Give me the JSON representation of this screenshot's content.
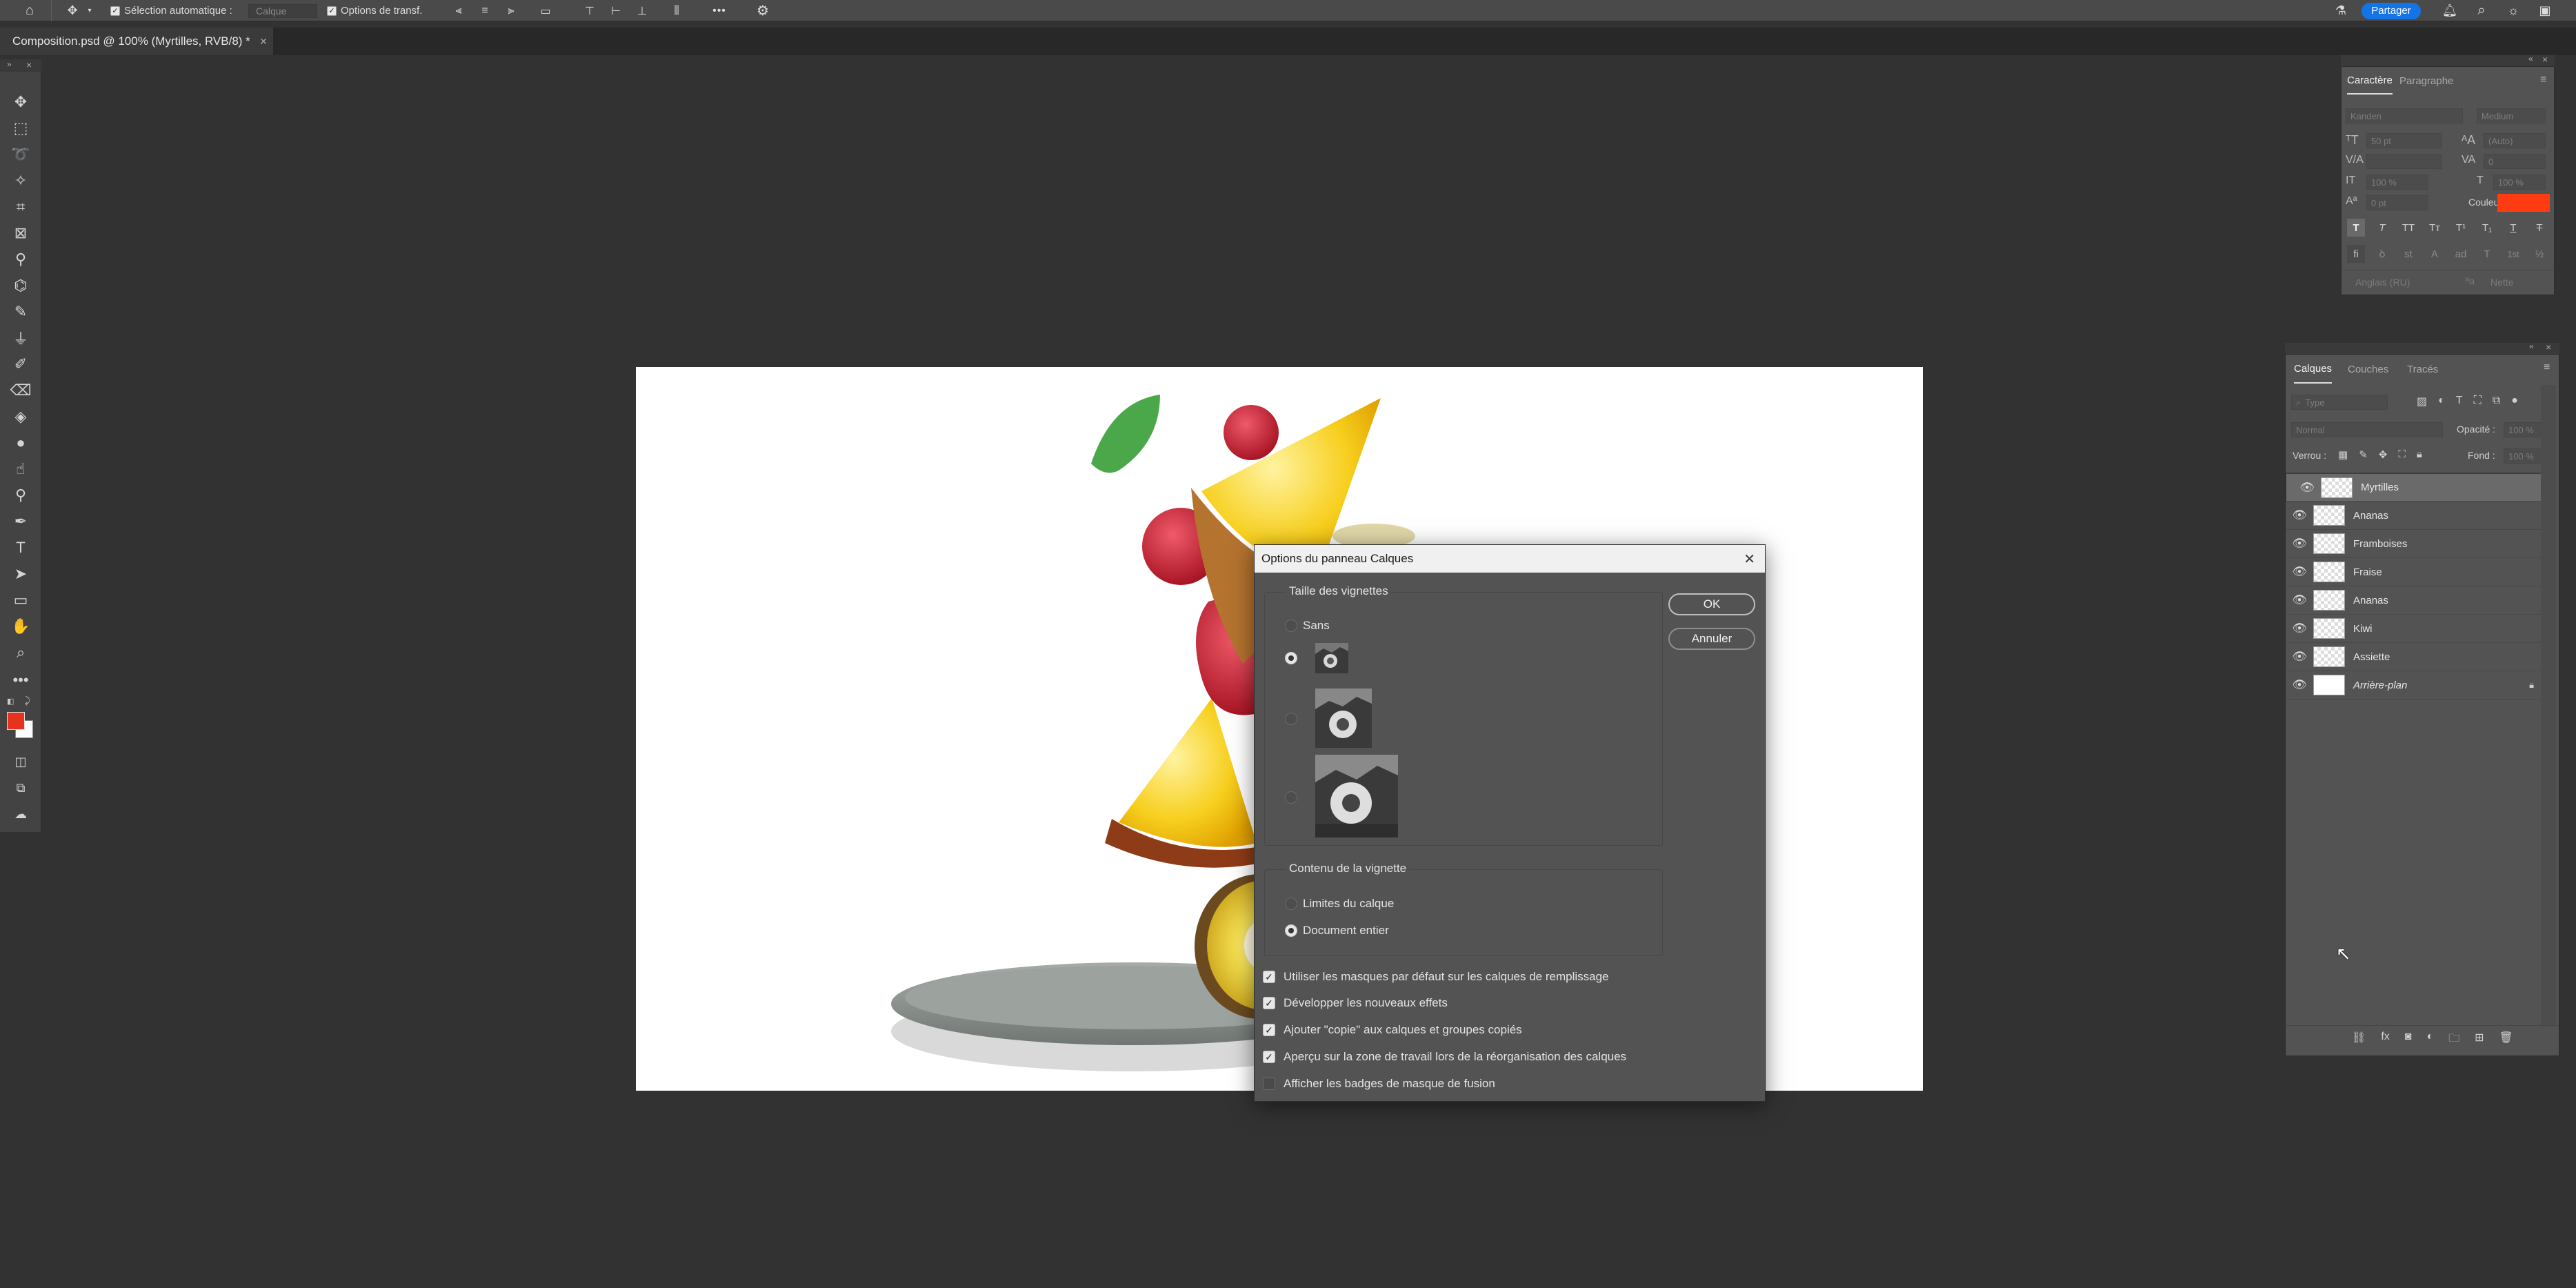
{
  "optbar": {
    "auto_select_label": "Sélection automatique :",
    "auto_select_target": "Calque",
    "transform_label": "Options de transf.",
    "more_label": "•••",
    "share_label": "Partager"
  },
  "document": {
    "tab_title": "Composition.psd @ 100% (Myrtilles, RVB/8) *",
    "close": "×"
  },
  "colors": {
    "foreground": "#e8321e",
    "background": "#ffffff",
    "share_button": "#1473e6",
    "text_color_swatch": "#ff3b12"
  },
  "dialog": {
    "title": "Options du panneau Calques",
    "close": "✕",
    "thumb_size_group": "Taille des vignettes",
    "thumb_none": "Sans",
    "thumb_sizes_selected_index": 1,
    "thumb_content_group": "Contenu de la vignette",
    "content_layer_bounds": "Limites du calque",
    "content_entire_doc": "Document entier",
    "content_selected": "Document entier",
    "ok": "OK",
    "cancel": "Annuler",
    "checkboxes": [
      {
        "label": "Utiliser les masques par défaut sur les calques de remplissage",
        "checked": true
      },
      {
        "label": "Développer les nouveaux effets",
        "checked": true
      },
      {
        "label": "Ajouter \"copie\" aux calques et groupes copiés",
        "checked": true
      },
      {
        "label": "Aperçu sur la zone de travail lors de la réorganisation des calques",
        "checked": true
      },
      {
        "label": "Afficher les badges de masque de fusion",
        "checked": false
      }
    ]
  },
  "character_panel": {
    "tabs": [
      "Caractère",
      "Paragraphe"
    ],
    "font_family": "Kanden",
    "font_style": "Medium",
    "font_size": "50 pt",
    "leading": "(Auto)",
    "kerning": "",
    "tracking": "0",
    "vscale": "100 %",
    "hscale": "100 %",
    "baseline": "0 pt",
    "color_label": "Couleur :",
    "language": "Anglais (RU)",
    "antialias": "Nette",
    "style_row1": [
      "T",
      "T",
      "TT",
      "Tт",
      "T¹",
      "T₁",
      "T",
      "T"
    ],
    "style_row2": [
      "fi",
      "ꝺ",
      "st",
      "A",
      "ad",
      "T",
      "1st",
      "½"
    ]
  },
  "layers_panel": {
    "tabs": [
      "Calques",
      "Couches",
      "Tracés"
    ],
    "filter_placeholder": "Type",
    "blend_mode": "Normal",
    "opacity_label": "Opacité :",
    "opacity_value": "100 %",
    "lock_label": "Verrou :",
    "fill_label": "Fond :",
    "fill_value": "100 %",
    "layers": [
      {
        "name": "Myrtilles",
        "selected": true,
        "locked": false
      },
      {
        "name": "Ananas",
        "selected": false,
        "locked": false
      },
      {
        "name": "Framboises",
        "selected": false,
        "locked": false
      },
      {
        "name": "Fraise",
        "selected": false,
        "locked": false
      },
      {
        "name": "Ananas",
        "selected": false,
        "locked": false
      },
      {
        "name": "Kiwi",
        "selected": false,
        "locked": false
      },
      {
        "name": "Assiette",
        "selected": false,
        "locked": false
      },
      {
        "name": "Arrière-plan",
        "selected": false,
        "locked": true
      }
    ]
  }
}
